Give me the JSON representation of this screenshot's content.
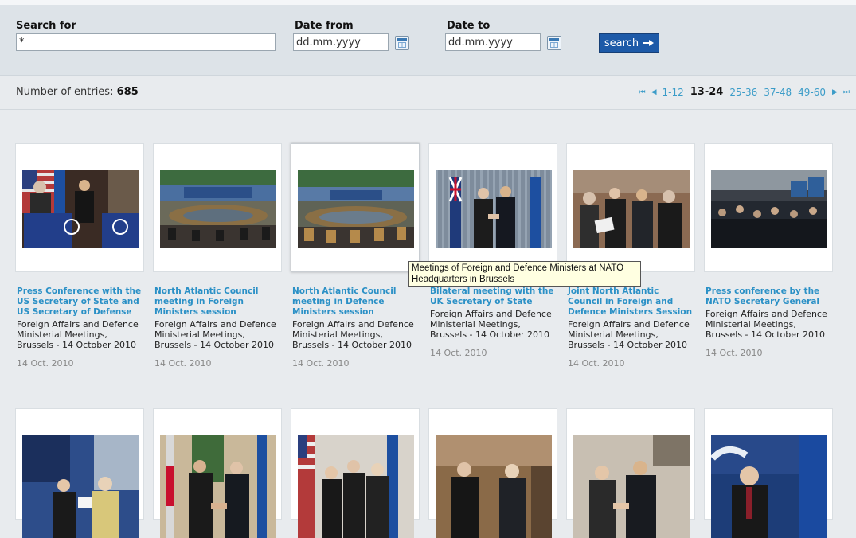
{
  "search": {
    "label_search_for": "Search for",
    "search_value": "*",
    "label_date_from": "Date from",
    "date_from_placeholder": "dd.mm.yyyy",
    "label_date_to": "Date to",
    "date_to_placeholder": "dd.mm.yyyy",
    "button_label": "search"
  },
  "results": {
    "count_label": "Number of entries:",
    "count_value": "685"
  },
  "pager": {
    "first": "⏮",
    "prev": "◀",
    "pages": [
      "1-12",
      "13-24",
      "25-36",
      "37-48",
      "49-60"
    ],
    "current": "13-24",
    "next": "▶",
    "last": "⏭"
  },
  "items": [
    {
      "title": "Press Conference with the US Secretary of State and US Secretary of Defense",
      "description": "Foreign Affairs and Defence Ministerial Meetings, Brussels - 14 October 2010",
      "date": "14 Oct. 2010"
    },
    {
      "title": "North Atlantic Council meeting in Foreign Ministers session",
      "description": "Foreign Affairs and Defence Ministerial Meetings, Brussels - 14 October 2010",
      "date": "14 Oct. 2010"
    },
    {
      "title": "North Atlantic Council meeting in Defence Ministers session",
      "description": "Foreign Affairs and Defence Ministerial Meetings, Brussels - 14 October 2010",
      "date": "14 Oct. 2010"
    },
    {
      "title": "Bilateral meeting with the UK Secretary of State",
      "description": "Foreign Affairs and Defence Ministerial Meetings, Brussels - 14 October 2010",
      "date": "14 Oct. 2010"
    },
    {
      "title": "Joint North Atlantic Council in Foreign and Defence Ministers Session",
      "description": "Foreign Affairs and Defence Ministerial Meetings, Brussels - 14 October 2010",
      "date": "14 Oct. 2010"
    },
    {
      "title": "Press conference by the NATO Secretary General",
      "description": "Foreign Affairs and Defence Ministerial Meetings, Brussels - 14 October 2010",
      "date": "14 Oct. 2010"
    }
  ],
  "tooltip": {
    "text": "Meetings of Foreign and Defence Ministers at NATO Headquarters in Brussels"
  },
  "colors": {
    "link": "#2a90c6",
    "button": "#1d5aa8",
    "background": "#e8ebee"
  }
}
